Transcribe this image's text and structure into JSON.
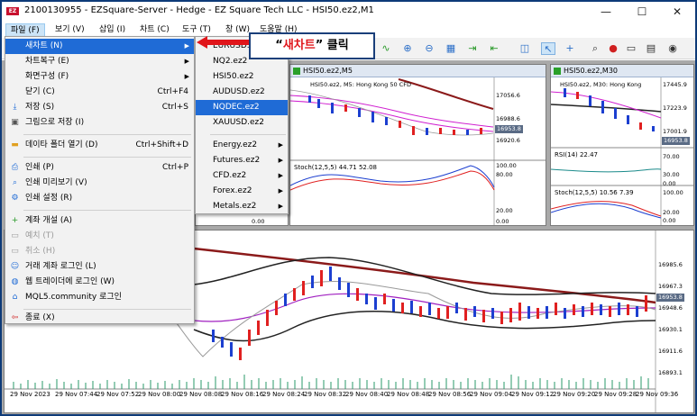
{
  "window": {
    "title": "2100130955 - EZSquare-Server - Hedge - EZ Square Tech LLC - HSI50.ez2,M1",
    "logo": "EZ",
    "minimize": "—",
    "maximize": "☐",
    "close": "✕"
  },
  "menubar": [
    {
      "label": "파일 (F)"
    },
    {
      "label": "보기 (V)"
    },
    {
      "label": "삽입 (I)"
    },
    {
      "label": "차트 (C)"
    },
    {
      "label": "도구 (T)"
    },
    {
      "label": "창 (W)"
    },
    {
      "label": "도움말 (H)"
    }
  ],
  "file_menu": [
    {
      "label": "새차트 (N)",
      "icon": "",
      "shortcut": "",
      "submenu": true,
      "highlight": true
    },
    {
      "label": "차트복구 (E)",
      "icon": "",
      "shortcut": "",
      "submenu": true
    },
    {
      "label": "화면구성 (F)",
      "icon": "",
      "shortcut": "",
      "submenu": true
    },
    {
      "label": "닫기 (C)",
      "icon": "",
      "shortcut": "Ctrl+F4"
    },
    {
      "label": "저장 (S)",
      "icon": "download-icon",
      "shortcut": "Ctrl+S"
    },
    {
      "label": "그림으로 저장 (I)",
      "icon": "image-icon",
      "shortcut": ""
    },
    {
      "label": "데이타 폴더 열기 (D)",
      "icon": "folder-icon",
      "shortcut": "Ctrl+Shift+D"
    },
    {
      "label": "인쇄 (P)",
      "icon": "printer-icon",
      "shortcut": "Ctrl+P"
    },
    {
      "label": "인쇄 미리보기 (V)",
      "icon": "print-preview-icon",
      "shortcut": ""
    },
    {
      "label": "인쇄 설정 (R)",
      "icon": "print-setup-icon",
      "shortcut": ""
    },
    {
      "label": "계좌 개설 (A)",
      "icon": "plus-icon",
      "shortcut": ""
    },
    {
      "label": "예치 (T)",
      "icon": "deposit-icon",
      "shortcut": "",
      "disabled": true
    },
    {
      "label": "취소 (H)",
      "icon": "withdraw-icon",
      "shortcut": "",
      "disabled": true
    },
    {
      "label": "거래 계좌 로그인 (L)",
      "icon": "user-icon",
      "shortcut": ""
    },
    {
      "label": "웹 트레이더에 로그인 (W)",
      "icon": "globe-icon",
      "shortcut": ""
    },
    {
      "label": "MQL5.community 로그인",
      "icon": "graduation-cap-icon",
      "shortcut": ""
    },
    {
      "label": "종료 (X)",
      "icon": "exit-icon",
      "shortcut": ""
    }
  ],
  "submenu": [
    {
      "label": "EURUSD.ez2",
      "submenu": false
    },
    {
      "label": "NQ2.ez2",
      "submenu": false
    },
    {
      "label": "HSI50.ez2",
      "submenu": false
    },
    {
      "label": "AUDUSD.ez2",
      "submenu": false
    },
    {
      "label": "NQDEC.ez2",
      "submenu": false,
      "highlight": true
    },
    {
      "label": "XAUUSD.ez2",
      "submenu": false
    },
    {
      "label": "Energy.ez2",
      "submenu": true
    },
    {
      "label": "Futures.ez2",
      "submenu": true
    },
    {
      "label": "CFD.ez2",
      "submenu": true
    },
    {
      "label": "Forex.ez2",
      "submenu": true
    },
    {
      "label": "Metals.ez2",
      "submenu": true
    }
  ],
  "callout": {
    "open_quote": "“",
    "highlight": "새차트",
    "close_quote": "”",
    "suffix": " 클릭"
  },
  "charts": {
    "m5": {
      "caption": "HSI50.ez2,M5",
      "header": "HSI50.ez2, M5:  Hong Kong 50 CFD",
      "prices": [
        "17056.6",
        "16988.6",
        "16953.8",
        "16920.6"
      ],
      "stoch_label": "Stoch(12,5,5) 44.71 52.08",
      "stoch_levels": [
        "100.00",
        "80.00",
        "20.00",
        "0.00"
      ]
    },
    "m30": {
      "caption": "HSI50.ez2,M30",
      "header": "HSI50.ez2, M30:  Hong Kong",
      "prices": [
        "17445.9",
        "17223.9",
        "17001.9",
        "16953.8"
      ],
      "rsi_label": "RSI(14) 22.47",
      "rsi_levels": [
        "70.00",
        "30.00",
        "0.00"
      ],
      "stoch_label": "Stoch(12,5,5) 10.56 7.39",
      "stoch_levels": [
        "100.00",
        "20.00",
        "0.00"
      ]
    },
    "m1": {
      "prices": [
        "16985.6",
        "16967.3",
        "16953.8",
        "16948.6",
        "16930.1",
        "16911.6",
        "16893.1"
      ],
      "time_labels": [
        "29 Nov 2023",
        "29 Nov 07:44",
        "29 Nov 07:52",
        "29 Nov 08:00",
        "29 Nov 08:08",
        "29 Nov 08:16",
        "29 Nov 08:24",
        "29 Nov 08:32",
        "29 Nov 08:40",
        "29 Nov 08:48",
        "29 Nov 08:56",
        "29 Nov 09:04",
        "29 Nov 09:12",
        "29 Nov 09:20",
        "29 Nov 09:28",
        "29 Nov 09:36"
      ]
    },
    "left_hidden_label": "0.00"
  },
  "colors": {
    "highlight": "#1f6bd6",
    "callout_red": "#e0161b",
    "bull": "#e02020",
    "bear": "#1c3fd0"
  }
}
